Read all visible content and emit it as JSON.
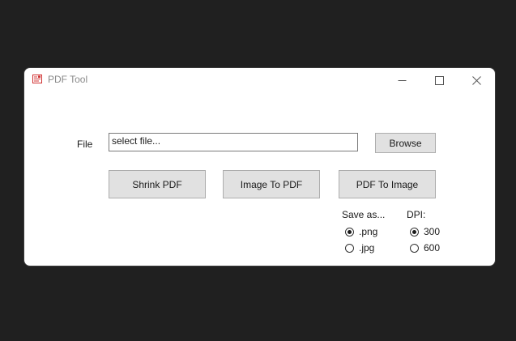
{
  "window": {
    "title": "PDF Tool",
    "icon": "pdf-app-icon",
    "controls": [
      "minimize-icon",
      "maximize-icon",
      "close-icon"
    ]
  },
  "file": {
    "label": "File",
    "value": "select file...",
    "browse_label": "Browse"
  },
  "actions": {
    "shrink_label": "Shrink PDF",
    "image_to_pdf_label": "Image To PDF",
    "pdf_to_image_label": "PDF To Image"
  },
  "save_as": {
    "label": "Save as...",
    "options": [
      {
        "label": ".png",
        "checked": true
      },
      {
        "label": ".jpg",
        "checked": false
      }
    ]
  },
  "dpi": {
    "label": "DPI:",
    "options": [
      {
        "label": "300",
        "checked": true
      },
      {
        "label": "600",
        "checked": false
      }
    ]
  },
  "colors": {
    "desktop": "#202020",
    "window": "#ffffff",
    "button_face": "#e1e1e1",
    "icon_red": "#d03030"
  }
}
